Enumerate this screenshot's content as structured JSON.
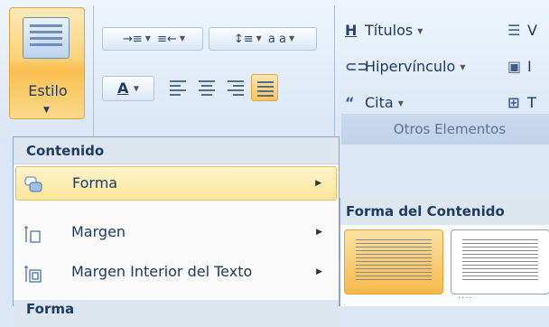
{
  "style_button": {
    "label": "Estilo"
  },
  "paragraph": {
    "indent_inc_label": "→≡",
    "indent_dec_label": "≡←",
    "line_spacing_label": "↕≡",
    "char_spacing_label": "a a",
    "font_color_label": "A"
  },
  "otros": {
    "titulos_label": "Títulos",
    "hipervinculo_label": "Hipervínculo",
    "cita_label": "Cita",
    "partial_1": "V",
    "partial_2": "I",
    "partial_3": "T",
    "group_label": "Otros Elementos"
  },
  "menu": {
    "header": "Contenido",
    "items": [
      {
        "label": "Forma",
        "icon": "shape-icon",
        "highlighted": true
      },
      {
        "label": "Margen",
        "icon": "margin-icon"
      },
      {
        "label": "Margen Interior del Texto",
        "icon": "padding-icon"
      }
    ],
    "footer": "Forma"
  },
  "gallery": {
    "header": "Forma del Contenido"
  },
  "colors": {
    "accent": "#f9be4e",
    "ribbon": "#dbe7f6",
    "text": "#1d3b63"
  }
}
